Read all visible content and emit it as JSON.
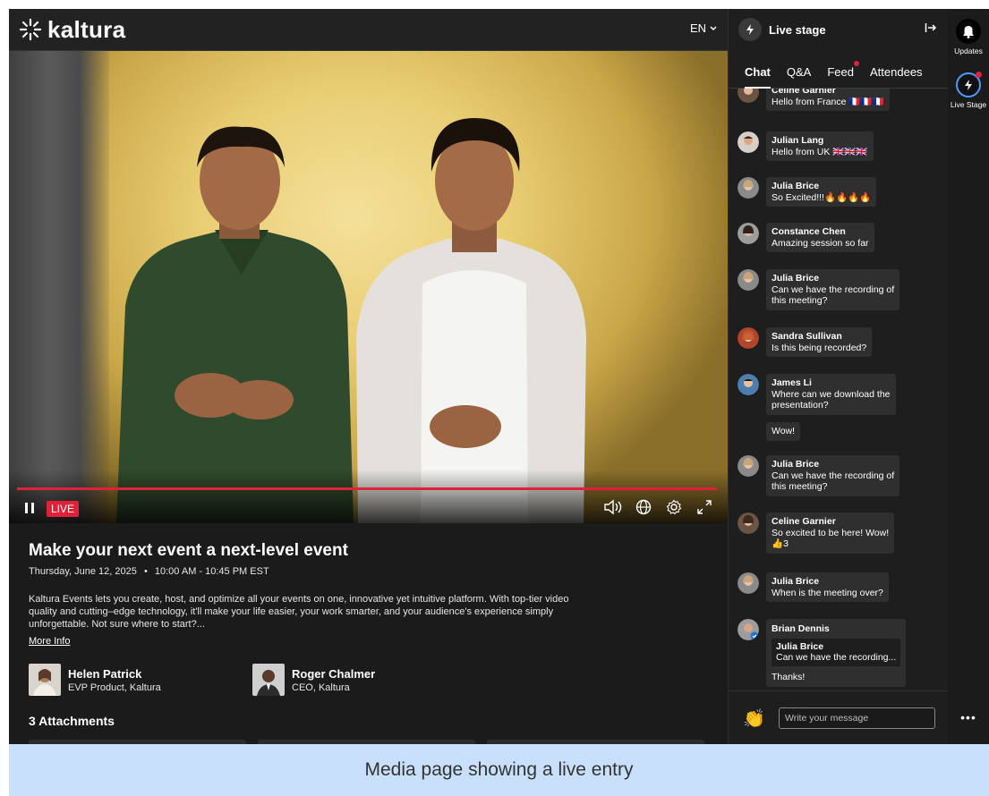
{
  "header": {
    "logo_text": "kaltura",
    "language": "EN"
  },
  "player": {
    "live_label": "LIVE",
    "controls": [
      "pause-icon",
      "volume-icon",
      "globe-icon",
      "settings-icon",
      "fullscreen-icon"
    ],
    "accent_color": "#e0213a"
  },
  "event": {
    "title": "Make your next event a next-level event",
    "date": "Thursday, June 12, 2025",
    "separator": "•",
    "time": "10:00 AM - 10:45 PM EST",
    "description": "Kaltura Events lets you create, host, and optimize all your events on one, innovative yet intuitive platform. With top-tier video quality and cutting–edge technology, it'll make your life easier, your work smarter, and your audience's experience simply unforgettable. Not sure where to start?...",
    "more_info": "More Info",
    "speakers": [
      {
        "name": "Helen Patrick",
        "role": "EVP Product, Kaltura"
      },
      {
        "name": "Roger Chalmer",
        "role": "CEO, Kaltura"
      }
    ],
    "attachments_heading": "3 Attachments"
  },
  "panel": {
    "title": "Live stage",
    "tabs": [
      "Chat",
      "Q&A",
      "Feed",
      "Attendees"
    ],
    "messages": [
      {
        "name": "Celine Garnier",
        "text": "Hello from France 🇫🇷🇫🇷🇫🇷"
      },
      {
        "name": "Julian Lang",
        "text": "Hello from UK 🇬🇧🇬🇧🇬🇧"
      },
      {
        "name": "Julia Brice",
        "text": "So Excited!!!🔥🔥🔥🔥"
      },
      {
        "name": "Constance Chen",
        "text": "Amazing session so far"
      },
      {
        "name": "Julia Brice",
        "text": "Can we have the recording of",
        "text2": "this meeting?"
      },
      {
        "name": "Sandra Sullivan",
        "text": "Is this being recorded?"
      },
      {
        "name": "James Li",
        "text": "Where can we download the",
        "text2": "presentation?",
        "followup": "Wow!"
      },
      {
        "name": "Julia Brice",
        "text": "Can we have the recording of",
        "text2": "this meeting?"
      },
      {
        "name": "Celine Garnier",
        "text": "So excited to be here! Wow!",
        "reaction": "👍",
        "reaction_count": "3"
      },
      {
        "name": "Julia Brice",
        "text": "When is the meeting over?"
      },
      {
        "name": "Brian Dennis",
        "quote_name": "Julia Brice",
        "quote_text": "Can we have the recording...",
        "text": "Thanks!"
      }
    ],
    "composer_placeholder": "Write your message",
    "clap_emoji": "👏"
  },
  "rail": {
    "updates_label": "Updates",
    "live_stage_label": "Live Stage",
    "more": "•••"
  },
  "caption": "Media page showing a live entry"
}
